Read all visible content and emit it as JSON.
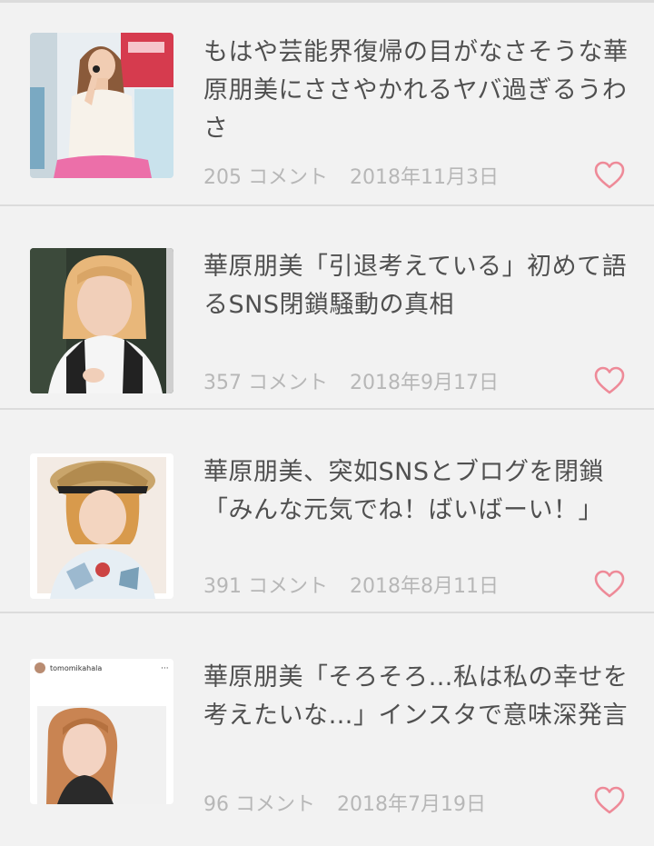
{
  "articles": [
    {
      "title": "もはや芸能界復帰の目がなさそうな華原朋美にささやかれるヤバ過ぎるうわさ",
      "comment_count": "205",
      "comment_label": "コメント",
      "date": "2018年11月3日"
    },
    {
      "title": "華原朋美「引退考えている」初めて語るSNS閉鎖騒動の真相",
      "comment_count": "357",
      "comment_label": "コメント",
      "date": "2018年9月17日"
    },
    {
      "title": "華原朋美、突如SNSとブログを閉鎖「みんな元気でね！ばいばーい！」",
      "comment_count": "391",
      "comment_label": "コメント",
      "date": "2018年8月11日"
    },
    {
      "title": "華原朋美「そろそろ…私は私の幸せを考えたいな…」インスタで意味深発言",
      "comment_count": "96",
      "comment_label": "コメント",
      "date": "2018年7月19日",
      "thumb_username": "tomomikahala"
    }
  ],
  "colors": {
    "heart": "#ee8a98",
    "title_text": "#505050",
    "meta_text": "#b7b7b7",
    "background": "#f2f2f2"
  },
  "icons": {
    "like": "heart-outline-icon"
  }
}
